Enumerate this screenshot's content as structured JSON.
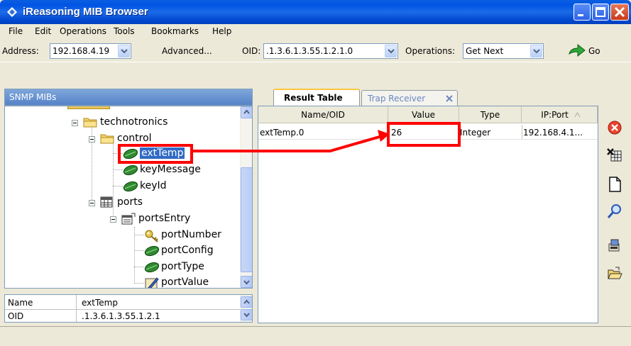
{
  "window": {
    "title": "iReasoning MIB Browser"
  },
  "menu": [
    "File",
    "Edit",
    "Operations",
    "Tools",
    "Bookmarks",
    "Help"
  ],
  "toolbar": {
    "address_label": "Address:",
    "address_value": "192.168.4.19",
    "advanced_label": "Advanced...",
    "oid_label": "OID:",
    "oid_value": ".1.3.6.1.3.55.1.2.1.0",
    "operations_label": "Operations:",
    "operations_value": "Get Next",
    "go_label": "Go"
  },
  "left_panel": {
    "header": "SNMP MIBs",
    "tree": [
      {
        "label": "technotronics",
        "icon": "folder-icon"
      },
      {
        "label": "control",
        "icon": "folder-icon"
      },
      {
        "label": "extTemp",
        "icon": "leaf-icon",
        "selected": true
      },
      {
        "label": "keyMessage",
        "icon": "leaf-icon"
      },
      {
        "label": "keyId",
        "icon": "leaf-icon"
      },
      {
        "label": "ports",
        "icon": "table-icon"
      },
      {
        "label": "portsEntry",
        "icon": "entry-icon"
      },
      {
        "label": "portNumber",
        "icon": "key-icon"
      },
      {
        "label": "portConfig",
        "icon": "leaf-icon"
      },
      {
        "label": "portType",
        "icon": "leaf-icon"
      },
      {
        "label": "portValue",
        "icon": "writable-icon"
      }
    ],
    "props": [
      {
        "key": "Name",
        "value": "extTemp"
      },
      {
        "key": "OID",
        "value": ".1.3.6.1.3.55.1.2.1"
      }
    ]
  },
  "tabs": [
    {
      "label": "Result Table",
      "active": true
    },
    {
      "label": "Trap Receiver",
      "active": false
    }
  ],
  "result_table": {
    "columns": [
      "Name/OID",
      "Value",
      "Type",
      "IP:Port"
    ],
    "rows": [
      {
        "name": "extTemp.0",
        "value": "26",
        "type": "Integer",
        "ipport": "192.168.4.1..."
      }
    ]
  },
  "colors": {
    "titlebar": "#0054E3",
    "annotation": "#FF0000",
    "selection": "#316AC5"
  }
}
